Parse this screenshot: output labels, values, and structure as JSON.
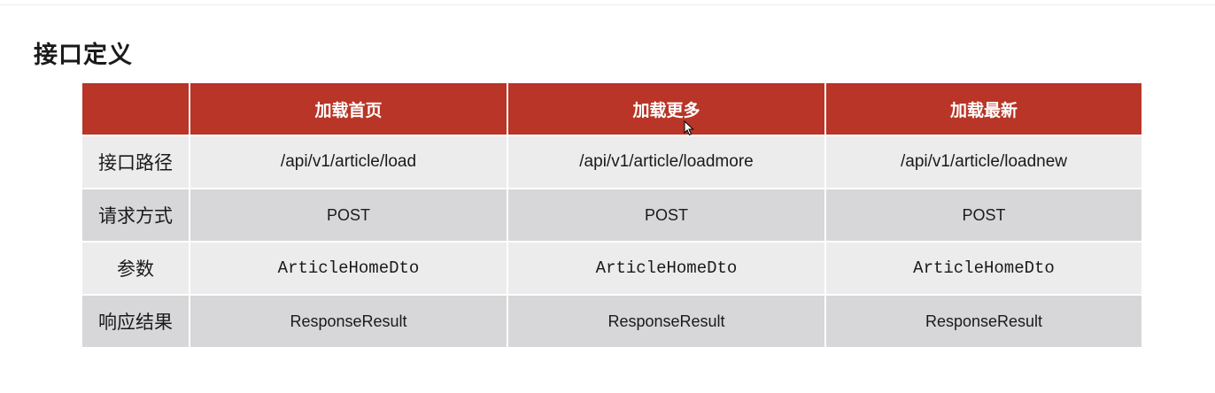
{
  "page": {
    "title": "接口定义"
  },
  "table": {
    "header": [
      "",
      "加载首页",
      "加载更多",
      "加载最新"
    ],
    "rows": [
      {
        "label": "接口路径",
        "cells": [
          "/api/v1/article/load",
          "/api/v1/article/loadmore",
          "/api/v1/article/loadnew"
        ]
      },
      {
        "label": "请求方式",
        "cells": [
          "POST",
          "POST",
          "POST"
        ]
      },
      {
        "label": "参数",
        "cells": [
          "ArticleHomeDto",
          "ArticleHomeDto",
          "ArticleHomeDto"
        ]
      },
      {
        "label": "响应结果",
        "cells": [
          "ResponseResult",
          "ResponseResult",
          "ResponseResult"
        ]
      }
    ]
  },
  "colors": {
    "header_bg": "#b83527",
    "row_light": "#ececec",
    "row_dark": "#d7d7d9"
  },
  "icons": {
    "cursor": "mouse-pointer-icon"
  }
}
